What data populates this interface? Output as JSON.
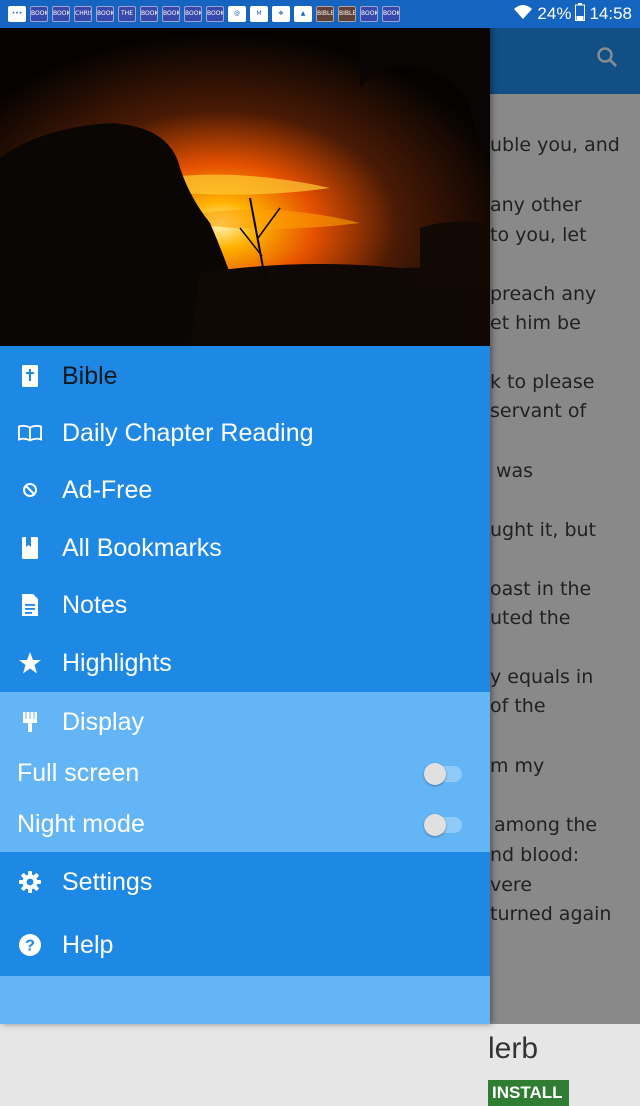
{
  "status_bar": {
    "notification_icons": [
      {
        "name": "messages-icon",
        "text": "•••",
        "style": "white"
      },
      {
        "name": "book-app-icon-1",
        "text": "BOOK"
      },
      {
        "name": "book-app-icon-2",
        "text": "BOOK"
      },
      {
        "name": "book-app-icon-3",
        "text": "CHRIST"
      },
      {
        "name": "book-app-icon-4",
        "text": "BOOK"
      },
      {
        "name": "the-gospel-app-icon",
        "text": "THE"
      },
      {
        "name": "book-app-icon-5",
        "text": "BOOK"
      },
      {
        "name": "book-app-icon-6",
        "text": "BOOK"
      },
      {
        "name": "book-app-icon-7",
        "text": "BOOK"
      },
      {
        "name": "book-app-icon-8",
        "text": "BOOK"
      },
      {
        "name": "at-sign-icon",
        "text": "@",
        "style": "white"
      },
      {
        "name": "gmail-icon",
        "text": "M",
        "style": "white"
      },
      {
        "name": "dropbox-icon",
        "text": "❖",
        "style": "white"
      },
      {
        "name": "gallery-icon",
        "text": "▲",
        "style": "white"
      },
      {
        "name": "bible-app-icon-1",
        "text": "BIBLE",
        "style": "brown"
      },
      {
        "name": "bible-app-icon-2",
        "text": "BIBLE",
        "style": "brown"
      },
      {
        "name": "book-app-icon-9",
        "text": "BOOK"
      },
      {
        "name": "book-app-icon-10",
        "text": "BOOK"
      }
    ],
    "battery": "24%",
    "time": "14:58"
  },
  "background_app": {
    "text_lines": [
      "uble you, and",
      "any other",
      "to you, let",
      "preach any",
      "et him be",
      "k to please",
      "servant of",
      "was",
      "ught it, but",
      "oast in the",
      "uted the",
      "y equals in",
      "of the",
      "m my",
      "among the",
      "nd blood:",
      "vere",
      "turned again"
    ],
    "ad": {
      "name_fragment": "lerb",
      "install_label": "INSTALL"
    }
  },
  "drawer": {
    "menu": [
      {
        "icon": "bible-book-icon",
        "label": "Bible",
        "highlight": true
      },
      {
        "icon": "open-book-icon",
        "label": "Daily Chapter Reading"
      },
      {
        "icon": "block-icon",
        "label": "Ad-Free"
      },
      {
        "icon": "bookmark-book-icon",
        "label": "All Bookmarks"
      },
      {
        "icon": "note-icon",
        "label": "Notes"
      },
      {
        "icon": "star-icon",
        "label": "Highlights"
      }
    ],
    "display": {
      "icon": "brush-icon",
      "label": "Display",
      "full_screen": {
        "label": "Full screen",
        "on": false
      },
      "night_mode": {
        "label": "Night mode",
        "on": false
      }
    },
    "footer": [
      {
        "icon": "gear-icon",
        "label": "Settings"
      },
      {
        "icon": "help-icon",
        "label": "Help"
      }
    ]
  }
}
